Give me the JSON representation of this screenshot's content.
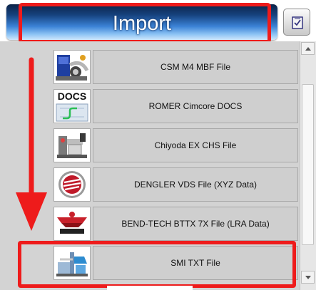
{
  "header": {
    "title": "Import",
    "settings_icon": "checklist-icon"
  },
  "list": {
    "items": [
      {
        "label": "CSM M4 MBF File",
        "icon": "tube-bender-icon",
        "icon_text": ""
      },
      {
        "label": "ROMER Cimcore DOCS",
        "icon": "romer-docs-icon",
        "icon_text": "DOCS"
      },
      {
        "label": "Chiyoda EX CHS File",
        "icon": "chiyoda-machine-icon",
        "icon_text": ""
      },
      {
        "label": "DENGLER VDS File (XYZ Data)",
        "icon": "dengler-logo-icon",
        "icon_text": ""
      },
      {
        "label": "BEND-TECH BTTX 7X File (LRA Data)",
        "icon": "bend-tech-logo-icon",
        "icon_text": ""
      },
      {
        "label": "SMI TXT File",
        "icon": "smi-machine-icon",
        "icon_text": ""
      }
    ]
  },
  "colors": {
    "annotation": "#ee1b1b",
    "title_bar_top": "#0b2348",
    "title_bar_bottom": "#cfe6fb",
    "row_background": "#cfcfcf"
  }
}
